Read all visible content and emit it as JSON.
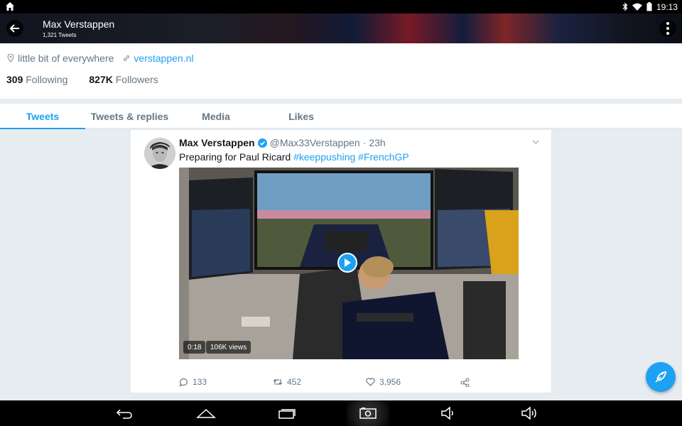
{
  "status_bar": {
    "time": "19:13",
    "icons": [
      "home-icon",
      "bluetooth-icon",
      "wifi-icon",
      "battery-icon"
    ]
  },
  "header": {
    "name": "Max Verstappen",
    "tweet_count": "1,321 Tweets"
  },
  "profile": {
    "location": "little bit of everywhere",
    "website": "verstappen.nl",
    "following_count": "309",
    "following_label": "Following",
    "followers_count": "827K",
    "followers_label": "Followers"
  },
  "tabs": [
    {
      "label": "Tweets",
      "active": true
    },
    {
      "label": "Tweets & replies",
      "active": false
    },
    {
      "label": "Media",
      "active": false
    },
    {
      "label": "Likes",
      "active": false
    }
  ],
  "tweet": {
    "name": "Max Verstappen",
    "handle": "@Max33Verstappen",
    "separator": "·",
    "time": "23h",
    "text_plain": "Preparing for Paul Ricard ",
    "hashtag1": "#keeppushing",
    "hashtag2": "#FrenchGP",
    "video": {
      "duration": "0:18",
      "views": "106K views"
    },
    "actions": {
      "replies": "133",
      "retweets": "452",
      "likes": "3,956"
    }
  },
  "colors": {
    "accent": "#1da1f2",
    "text": "#14171a",
    "muted": "#657786",
    "background": "#e6ecf0"
  }
}
